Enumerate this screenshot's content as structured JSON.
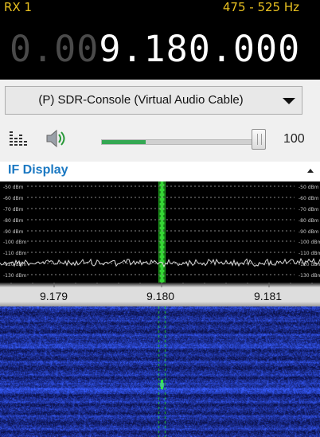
{
  "header": {
    "rx_label": "RX 1",
    "bandwidth": "475 - 525 Hz"
  },
  "frequency": {
    "dim_prefix": "0.00",
    "value": "9.180.000"
  },
  "audio_source": {
    "selected": "(P) SDR-Console (Virtual Audio Cable)"
  },
  "volume": {
    "value": "100",
    "level_percent": 28
  },
  "if_display": {
    "title": "IF Display",
    "db_labels_left": [
      "-50 dBm",
      "-60 dBm",
      "-70 dBm",
      "-80 dBm",
      "-90 dBm",
      "-100 dBm",
      "-110 dBm",
      "-120 dBm",
      "-130 dBm"
    ],
    "db_labels_right": [
      "-50 dBm",
      "-60 dBm",
      "-70 dBm",
      "-80 dBm",
      "-90 dBm",
      "-100 dBm",
      "-110 dBm",
      "-120 dBm",
      "-130 dBm"
    ],
    "freq_labels": [
      "9.179",
      "9.180",
      "9.181"
    ]
  },
  "colors": {
    "accent": "#e8c020",
    "title_blue": "#1a78c2",
    "marker_green": "#22cc22",
    "volume_green": "#34a853"
  }
}
